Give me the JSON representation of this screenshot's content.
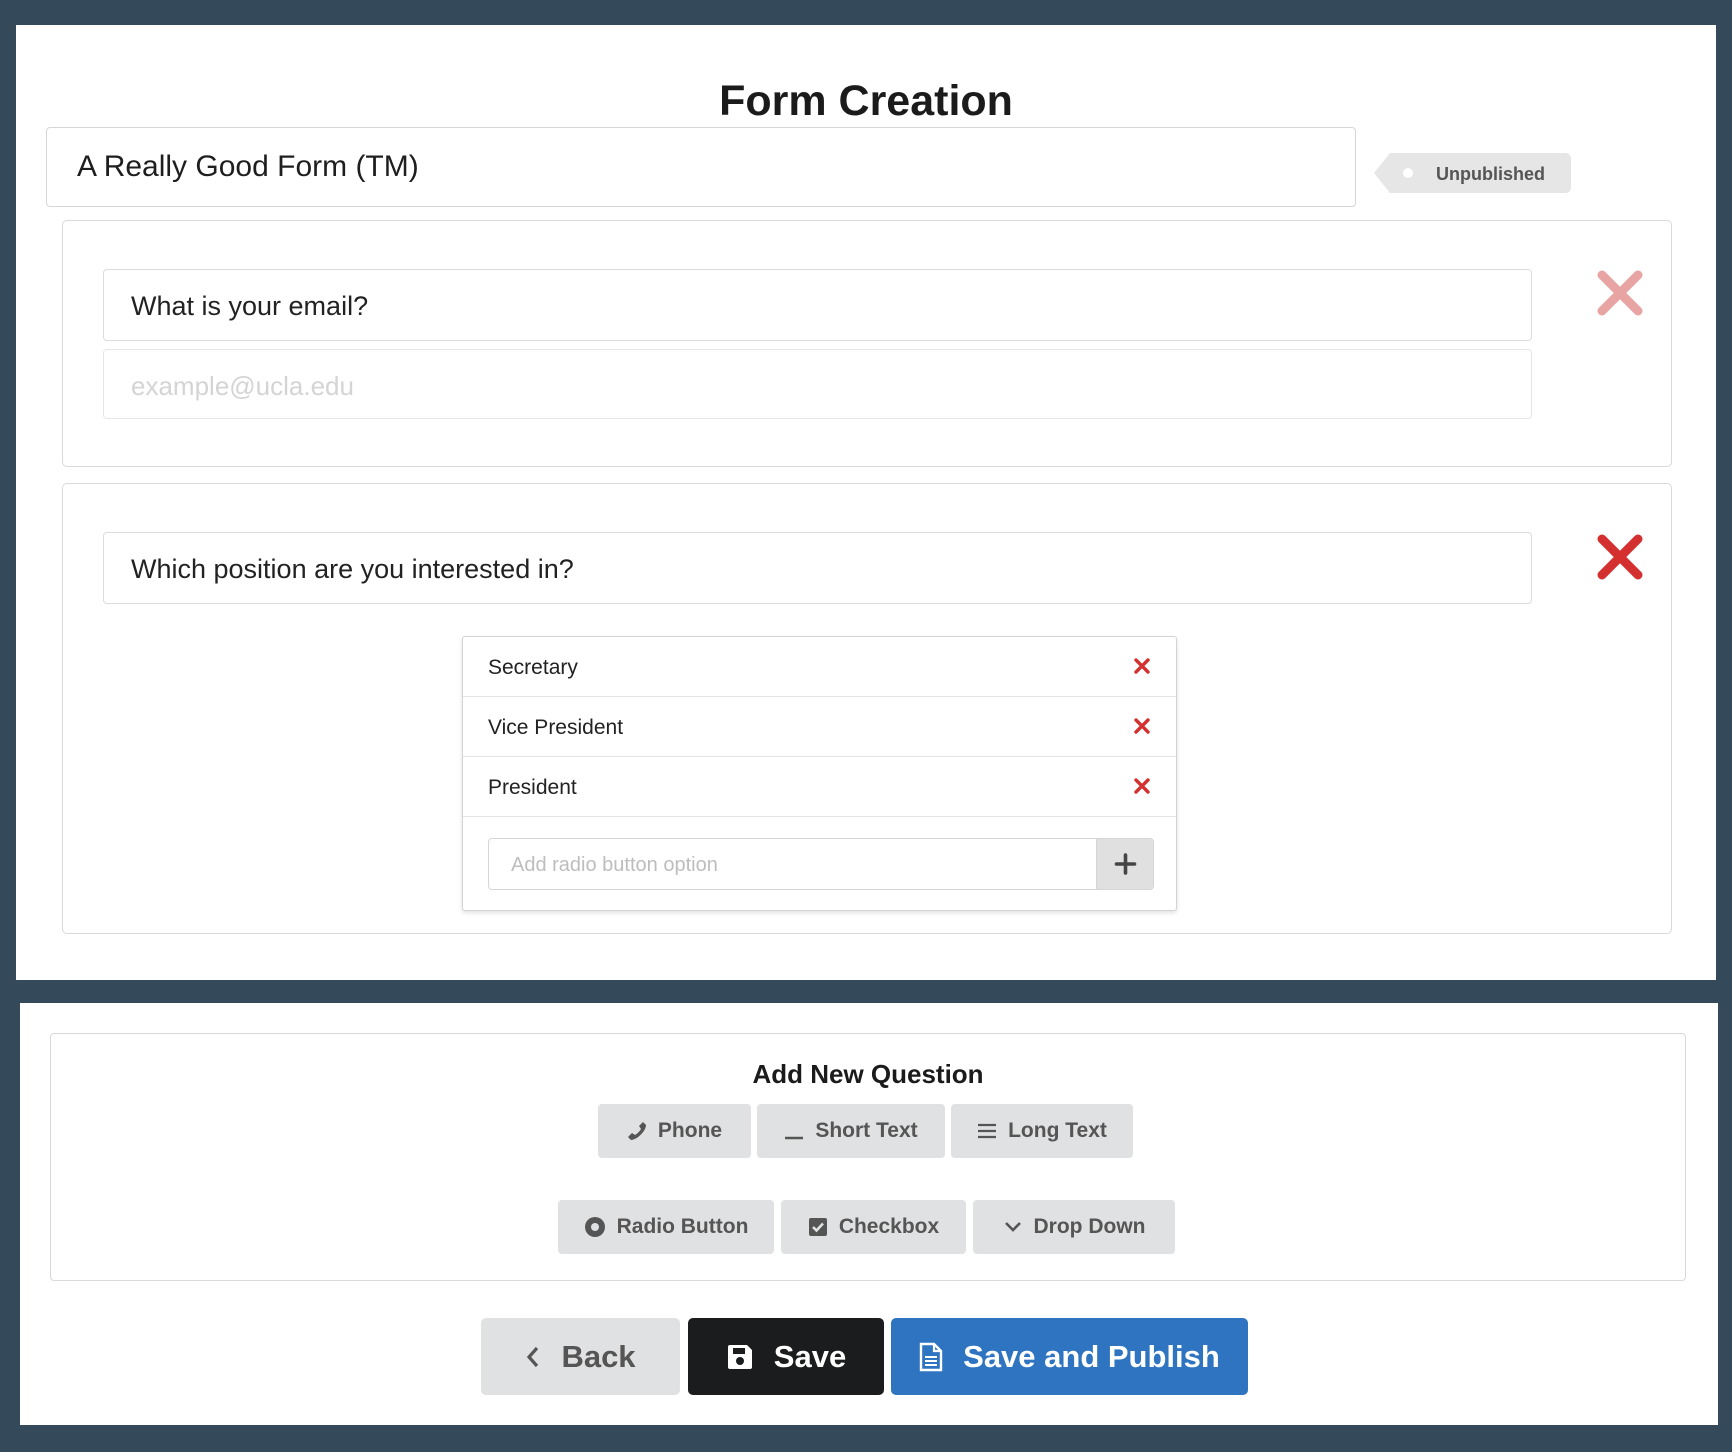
{
  "header": {
    "title": "Form Creation"
  },
  "form": {
    "title": "A Really Good Form (TM)",
    "status": "Unpublished"
  },
  "questions": [
    {
      "label": "What is your email?",
      "placeholder": "example@ucla.edu",
      "delete_icon": "close-icon",
      "delete_color": "#e8a3a3"
    },
    {
      "label": "Which position are you interested in?",
      "delete_icon": "close-icon",
      "delete_color": "#d3302f",
      "options": [
        "Secretary",
        "Vice President",
        "President"
      ],
      "add_option_placeholder": "Add radio button option",
      "add_option_icon": "plus-icon"
    }
  ],
  "add_question": {
    "title": "Add New Question",
    "types": [
      {
        "label": "Phone",
        "icon": "phone-icon"
      },
      {
        "label": "Short Text",
        "icon": "short-text-icon"
      },
      {
        "label": "Long Text",
        "icon": "long-text-icon"
      },
      {
        "label": "Radio Button",
        "icon": "radio-button-icon"
      },
      {
        "label": "Checkbox",
        "icon": "checkbox-icon"
      },
      {
        "label": "Drop Down",
        "icon": "chevron-down-icon"
      }
    ]
  },
  "actions": {
    "back": "Back",
    "save": "Save",
    "save_publish": "Save and Publish"
  },
  "colors": {
    "background": "#34495a",
    "delete_red": "#d3302f",
    "primary_blue": "#2f74c0",
    "dark_button": "#1b1c1d",
    "grey_button": "#e0e1e2"
  }
}
